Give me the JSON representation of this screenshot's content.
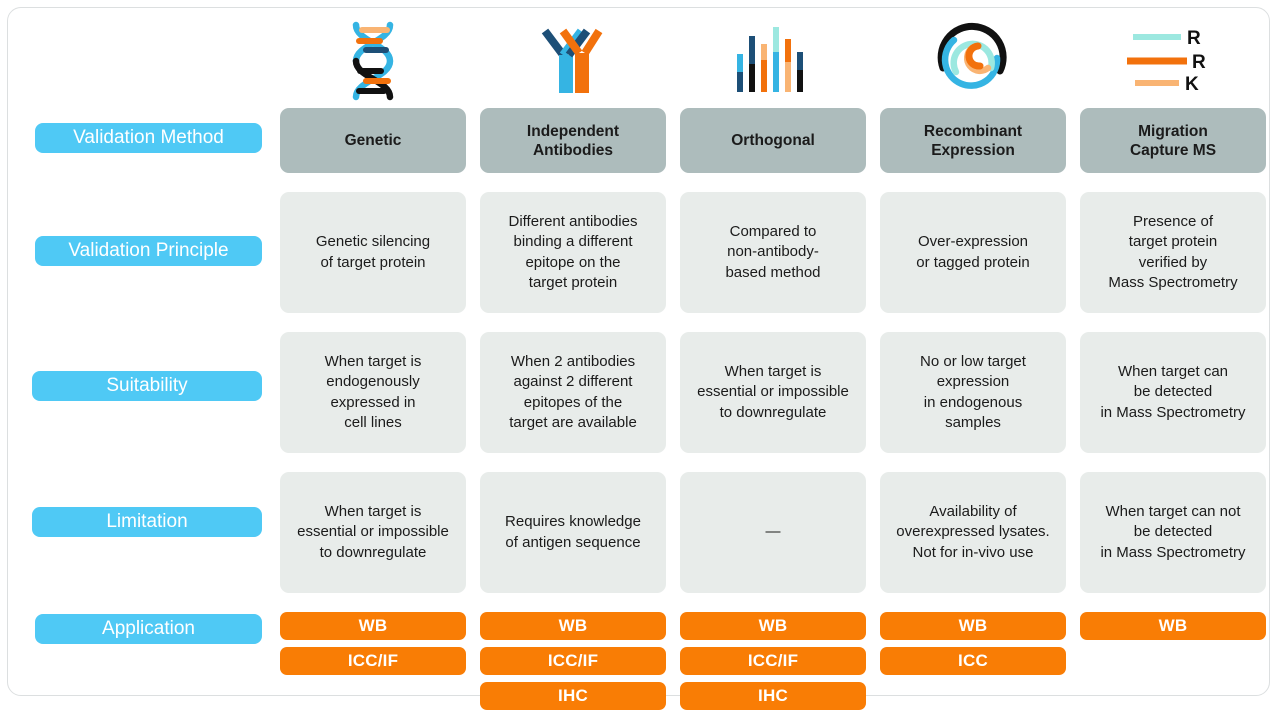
{
  "colors": {
    "label_pill": "#4fc9f5",
    "header_cell": "#adbcbc",
    "body_cell": "#e8ecea",
    "application_pill": "#f97d05",
    "icon_blue": "#35b4e3",
    "icon_navy": "#1d4f77",
    "icon_orange": "#f2710c",
    "icon_light_orange": "#f9b473",
    "icon_teal": "#9ce8e0",
    "icon_black": "#111111"
  },
  "row_labels": [
    {
      "id": "validation-method",
      "text": "Validation Method"
    },
    {
      "id": "validation-principle",
      "text": "Validation Principle"
    },
    {
      "id": "suitability",
      "text": "Suitability"
    },
    {
      "id": "limitation",
      "text": "Limitation"
    },
    {
      "id": "application",
      "text": "Application"
    }
  ],
  "columns": [
    {
      "icon": "dna-helix-icon",
      "method": "Genetic",
      "principle": "Genetic silencing\nof target protein",
      "suitability": "When target is\nendogenously\nexpressed in\ncell lines",
      "limitation": "When target is\nessential or impossible\nto downregulate",
      "applications": [
        "WB",
        "ICC/IF"
      ]
    },
    {
      "icon": "antibody-pair-icon",
      "method": "Independent\nAntibodies",
      "principle": "Different antibodies\nbinding a different\nepitope on the\ntarget protein",
      "suitability": "When 2 antibodies\nagainst 2 different\nepitopes of the\ntarget are available",
      "limitation": "Requires knowledge\nof antigen sequence",
      "applications": [
        "WB",
        "ICC/IF",
        "IHC"
      ]
    },
    {
      "icon": "spectrum-bars-icon",
      "method": "Orthogonal",
      "principle": "Compared to\nnon-antibody-\nbased method",
      "suitability": "When target is\nessential or impossible\nto downregulate",
      "limitation": "—",
      "applications": [
        "WB",
        "ICC/IF",
        "IHC"
      ]
    },
    {
      "icon": "recombinant-spiral-icon",
      "method": "Recombinant\nExpression",
      "principle": "Over-expression\nor tagged protein",
      "suitability": "No or low target\nexpression\nin endogenous\nsamples",
      "limitation": "Availability of\noverexpressed lysates.\nNot for in-vivo use",
      "applications": [
        "WB",
        "ICC"
      ]
    },
    {
      "icon": "ms-legend-icon",
      "method": "Migration\nCapture MS",
      "principle": "Presence of\ntarget protein\nverified by\nMass Spectrometry",
      "suitability": "When target can\nbe detected\nin Mass Spectrometry",
      "limitation": "When target can not\nbe detected\nin Mass Spectrometry",
      "applications": [
        "WB"
      ]
    }
  ],
  "ms_legend": {
    "entries": [
      {
        "label": "R",
        "color": "#9ce8e0"
      },
      {
        "label": "R",
        "color": "#f2710c"
      },
      {
        "label": "K",
        "color": "#f9b473"
      }
    ]
  }
}
